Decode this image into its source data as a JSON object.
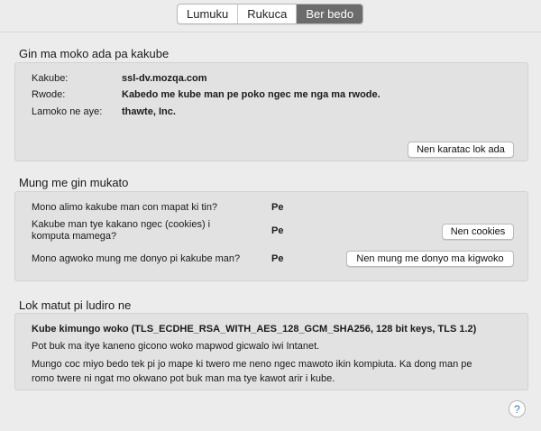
{
  "tabs": [
    {
      "label": "Lumuku",
      "active": false
    },
    {
      "label": "Rukuca",
      "active": false
    },
    {
      "label": "Ber bedo",
      "active": true
    }
  ],
  "identity": {
    "title": "Gin ma moko ada pa kakube",
    "website_label": "Kakube:",
    "website_value": "ssl-dv.mozqa.com",
    "owner_label": "Rwode:",
    "owner_value": "Kabedo me kube man pe poko ngec me nga ma rwode.",
    "verifier_label": "Lamoko ne aye:",
    "verifier_value": "thawte, Inc.",
    "view_cert_button": "Nen karatac lok ada"
  },
  "privacy": {
    "title": "Mung me gin mukato",
    "q1": "Mono alimo kakube man con mapat ki tin?",
    "a1": "Pe",
    "q2_line1": "Kakube man tye kakano ngec (cookies) i",
    "q2_line2": "komputa mamega?",
    "a2": "Pe",
    "cookies_button": "Nen cookies",
    "q3": "Mono agwoko mung me donyo pi kakube man?",
    "a3": "Pe",
    "passwords_button": "Nen mung me donyo ma kigwoko"
  },
  "technical": {
    "title": "Lok matut pi ludiro ne",
    "connection": "Kube kimungo woko (TLS_ECDHE_RSA_WITH_AES_128_GCM_SHA256, 128 bit keys, TLS 1.2)",
    "line1": "Pot buk ma itye kaneno gicono woko mapwod gicwalo iwi Intanet.",
    "line2a": "Mungo coc miyo bedo tek pi jo mape ki twero me neno ngec mawoto ikin kompiuta. Ka dong man pe",
    "line2b": "romo twere ni ngat mo okwano pot buk man ma tye kawot arir i kube."
  },
  "help": {
    "glyph": "?"
  },
  "colors": {
    "active_tab": "#6b6b6b",
    "help_accent": "#3478c6"
  }
}
